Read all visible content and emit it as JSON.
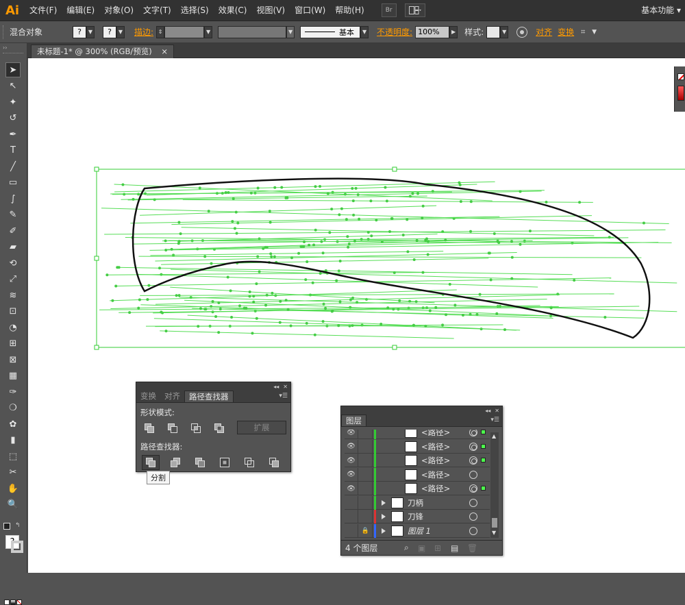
{
  "app": {
    "logo": "Ai",
    "workspace": "基本功能"
  },
  "menu": [
    "文件(F)",
    "编辑(E)",
    "对象(O)",
    "文字(T)",
    "选择(S)",
    "效果(C)",
    "视图(V)",
    "窗口(W)",
    "帮助(H)"
  ],
  "menu_icons": {
    "bridge": "Br",
    "arrange": "arrange-documents-icon"
  },
  "control": {
    "selection_label": "混合对象",
    "fill_value": "?",
    "stroke_value": "?",
    "stroke_label": "描边:",
    "stroke_style": "基本",
    "opacity_label": "不透明度:",
    "opacity_value": "100%",
    "style_label": "样式:",
    "align_label": "对齐",
    "transform_label": "变换"
  },
  "document": {
    "tab_title": "未标题-1* @ 300% (RGB/预览)",
    "close": "×"
  },
  "accent": {
    "selection": "#33cc33",
    "menu_bg": "#323232",
    "panel_bg": "#535353",
    "highlight": "#ff9a00"
  },
  "tools": [
    "selection-tool",
    "direct-selection-tool",
    "magic-wand-tool",
    "lasso-tool",
    "pen-tool",
    "type-tool",
    "line-tool",
    "rectangle-tool",
    "paintbrush-tool",
    "pencil-tool",
    "blob-brush-tool",
    "eraser-tool",
    "rotate-tool",
    "scale-tool",
    "warp-tool",
    "free-transform-tool",
    "shape-builder-tool",
    "perspective-grid-tool",
    "mesh-tool",
    "gradient-tool",
    "eyedropper-tool",
    "blend-tool",
    "symbol-sprayer-tool",
    "column-graph-tool",
    "artboard-tool",
    "slice-tool",
    "hand-tool",
    "zoom-tool"
  ],
  "pathfinder": {
    "tabs": [
      "变换",
      "对齐",
      "路径查找器"
    ],
    "shape_modes_label": "形状模式:",
    "expand_label": "扩展",
    "pathfinders_label": "路径查找器:",
    "tooltip": "分割"
  },
  "layers": {
    "tab": "图层",
    "rows": [
      {
        "name": "<路径>",
        "kind": "path",
        "visible": true,
        "selected": true,
        "partial": true
      },
      {
        "name": "<路径>",
        "kind": "path",
        "visible": true,
        "selected": true
      },
      {
        "name": "<路径>",
        "kind": "path",
        "visible": true,
        "selected": true
      },
      {
        "name": "<路径>",
        "kind": "path",
        "visible": true,
        "selected": false
      },
      {
        "name": "<路径>",
        "kind": "path",
        "visible": true,
        "selected": true
      },
      {
        "name": "刀柄",
        "kind": "layer",
        "visible": false,
        "color": "#33cc33"
      },
      {
        "name": "刀锋",
        "kind": "layer",
        "visible": false,
        "color": "#dd3333"
      },
      {
        "name": "图层 1",
        "kind": "layer",
        "visible": false,
        "locked": true,
        "color": "#3366ff"
      }
    ],
    "footer_count": "4 个图层"
  }
}
